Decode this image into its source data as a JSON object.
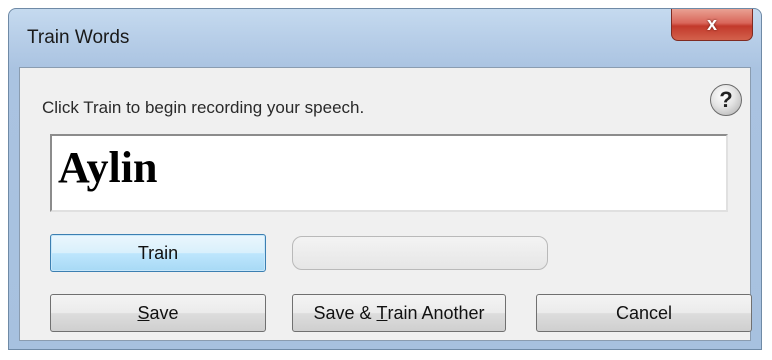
{
  "window": {
    "title": "Train Words",
    "close_label": "x"
  },
  "dialog": {
    "instruction": "Click Train to begin recording your speech.",
    "help_label": "?",
    "word": "Aylin",
    "progress_percent": 0
  },
  "buttons": {
    "train_label": "Train",
    "save_label": "Save",
    "save_mnemonic": "S",
    "save_rest": "ave",
    "save_train_label": "Save & Train Another",
    "save_train_prefix": "Save & ",
    "save_train_mnemonic": "T",
    "save_train_rest": "rain Another",
    "cancel_label": "Cancel"
  },
  "icons": {
    "close": "close-icon",
    "help": "help-icon"
  },
  "colors": {
    "title_bar": "#b7cee8",
    "close_button": "#c2392b",
    "focused_button_border": "#3c7fb1"
  }
}
